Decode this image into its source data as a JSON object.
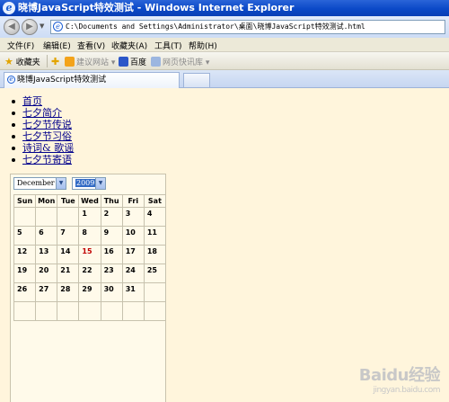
{
  "window": {
    "title": "晓博JavaScript特效测试 - Windows Internet Explorer"
  },
  "address": {
    "url": "C:\\Documents and Settings\\Administrator\\桌面\\晓博JavaScript特效测试.html"
  },
  "menu": {
    "items": [
      "文件(F)",
      "编辑(E)",
      "查看(V)",
      "收藏夹(A)",
      "工具(T)",
      "帮助(H)"
    ]
  },
  "favorites": {
    "label": "收藏夹",
    "suggested_sites": "建议网站",
    "baidu": "百度",
    "web_slice": "网页快讯库"
  },
  "tab": {
    "label": "晓博JavaScript特效测试"
  },
  "page": {
    "links": [
      "首页",
      "七夕简介",
      "七夕节传说",
      "七夕节习俗",
      "诗词& 歌谣",
      "七夕节寄语"
    ]
  },
  "calendar": {
    "month": "December",
    "year": "2009",
    "weekdays": [
      "Sun",
      "Mon",
      "Tue",
      "Wed",
      "Thu",
      "Fri",
      "Sat"
    ],
    "weeks": [
      [
        "",
        "",
        "",
        "1",
        "2",
        "3",
        "4"
      ],
      [
        "5",
        "6",
        "7",
        "8",
        "9",
        "10",
        "11"
      ],
      [
        "12",
        "13",
        "14",
        "15",
        "16",
        "17",
        "18"
      ],
      [
        "19",
        "20",
        "21",
        "22",
        "23",
        "24",
        "25"
      ],
      [
        "26",
        "27",
        "28",
        "29",
        "30",
        "31",
        ""
      ],
      [
        "",
        "",
        "",
        "",
        "",
        "",
        ""
      ]
    ],
    "today": "15",
    "today_color": "#c00000"
  },
  "watermark": {
    "text": "Baidu经验",
    "sub": "jingyan.baidu.com"
  }
}
